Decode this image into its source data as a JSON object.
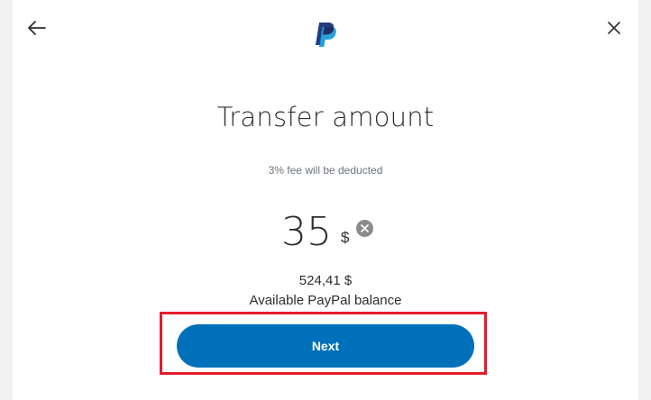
{
  "header": {
    "back_icon": "arrow-left-icon",
    "logo_icon": "paypal-logo-icon",
    "close_icon": "close-icon"
  },
  "main": {
    "title": "Transfer amount",
    "fee_note": "3% fee will be deducted",
    "amount": {
      "value": "35",
      "currency": "$",
      "clear_icon": "clear-circle-icon"
    },
    "balance": {
      "amount": "524,41 $",
      "label": "Available PayPal balance"
    },
    "next_button_label": "Next"
  },
  "colors": {
    "primary_button": "#0070ba",
    "highlight_frame": "#e31c2b",
    "logo_dark": "#253b80",
    "logo_light": "#179bd7"
  }
}
